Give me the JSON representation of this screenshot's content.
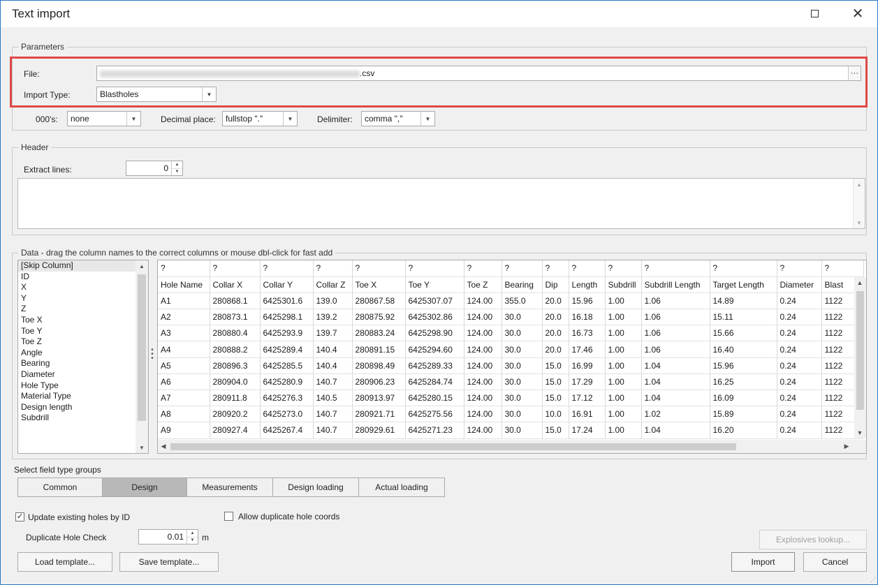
{
  "window": {
    "title": "Text import",
    "maximize_icon": "maximize-icon",
    "close_icon": "close-icon"
  },
  "parameters": {
    "group_label": "Parameters",
    "file_label": "File:",
    "file_value": ".csv",
    "browse_label": "···",
    "import_type_label": "Import Type:",
    "import_type_value": "Blastholes",
    "thousands_label": "000's:",
    "thousands_value": "none",
    "decimal_label": "Decimal place:",
    "decimal_value": "fullstop \".\"",
    "delimiter_label": "Delimiter:",
    "delimiter_value": "comma \",\""
  },
  "header": {
    "group_label": "Header",
    "extract_label": "Extract lines:",
    "extract_value": "0",
    "text_value": ""
  },
  "data": {
    "group_label": "Data - drag the column names to the correct columns or mouse dbl-click for fast add",
    "field_list": [
      "[Skip Column]",
      "ID",
      "X",
      "Y",
      "Z",
      "Toe X",
      "Toe Y",
      "Toe Z",
      "Angle",
      "Bearing",
      "Diameter",
      "Hole Type",
      "Material Type",
      "Design length",
      "Subdrill"
    ],
    "assigned_row": [
      "?",
      "?",
      "?",
      "?",
      "?",
      "?",
      "?",
      "?",
      "?",
      "?",
      "?",
      "?",
      "?",
      "?",
      "?"
    ],
    "columns": [
      "Hole Name",
      "Collar X",
      "Collar Y",
      "Collar Z",
      "Toe X",
      "Toe Y",
      "Toe Z",
      "Bearing",
      "Dip",
      "Length",
      "Subdrill",
      "Subdrill Length",
      "Target Length",
      "Diameter",
      "Blast"
    ],
    "rows": [
      [
        "A1",
        "280868.1",
        "6425301.6",
        "139.0",
        "280867.58",
        "6425307.07",
        "124.00",
        "355.0",
        "20.0",
        "15.96",
        "1.00",
        "1.06",
        "14.89",
        "0.24",
        "1122"
      ],
      [
        "A2",
        "280873.1",
        "6425298.1",
        "139.2",
        "280875.92",
        "6425302.86",
        "124.00",
        "30.0",
        "20.0",
        "16.18",
        "1.00",
        "1.06",
        "15.11",
        "0.24",
        "1122"
      ],
      [
        "A3",
        "280880.4",
        "6425293.9",
        "139.7",
        "280883.24",
        "6425298.90",
        "124.00",
        "30.0",
        "20.0",
        "16.73",
        "1.00",
        "1.06",
        "15.66",
        "0.24",
        "1122"
      ],
      [
        "A4",
        "280888.2",
        "6425289.4",
        "140.4",
        "280891.15",
        "6425294.60",
        "124.00",
        "30.0",
        "20.0",
        "17.46",
        "1.00",
        "1.06",
        "16.40",
        "0.24",
        "1122"
      ],
      [
        "A5",
        "280896.3",
        "6425285.5",
        "140.4",
        "280898.49",
        "6425289.33",
        "124.00",
        "30.0",
        "15.0",
        "16.99",
        "1.00",
        "1.04",
        "15.96",
        "0.24",
        "1122"
      ],
      [
        "A6",
        "280904.0",
        "6425280.9",
        "140.7",
        "280906.23",
        "6425284.74",
        "124.00",
        "30.0",
        "15.0",
        "17.29",
        "1.00",
        "1.04",
        "16.25",
        "0.24",
        "1122"
      ],
      [
        "A7",
        "280911.8",
        "6425276.3",
        "140.5",
        "280913.97",
        "6425280.15",
        "124.00",
        "30.0",
        "15.0",
        "17.12",
        "1.00",
        "1.04",
        "16.09",
        "0.24",
        "1122"
      ],
      [
        "A8",
        "280920.2",
        "6425273.0",
        "140.7",
        "280921.71",
        "6425275.56",
        "124.00",
        "30.0",
        "10.0",
        "16.91",
        "1.00",
        "1.02",
        "15.89",
        "0.24",
        "1122"
      ],
      [
        "A9",
        "280927.4",
        "6425267.4",
        "140.7",
        "280929.61",
        "6425271.23",
        "124.00",
        "30.0",
        "15.0",
        "17.24",
        "1.00",
        "1.04",
        "16.20",
        "0.24",
        "1122"
      ]
    ]
  },
  "field_groups": {
    "label": "Select field type groups",
    "tabs": [
      "Common",
      "Design",
      "Measurements",
      "Design loading",
      "Actual loading"
    ],
    "active": "Design"
  },
  "options": {
    "update_existing_label": "Update existing holes by ID",
    "update_existing_checked": true,
    "allow_duplicate_label": "Allow duplicate hole coords",
    "allow_duplicate_checked": false,
    "dup_check_label": "Duplicate Hole Check",
    "dup_check_value": "0.01",
    "dup_check_unit": "m"
  },
  "buttons": {
    "explosives_lookup": "Explosives lookup...",
    "load_template": "Load template...",
    "save_template": "Save template...",
    "import": "Import",
    "cancel": "Cancel"
  },
  "colors": {
    "highlight": "#e04848",
    "window_border": "#2b78c8",
    "active_tab": "#b8b8b8"
  }
}
